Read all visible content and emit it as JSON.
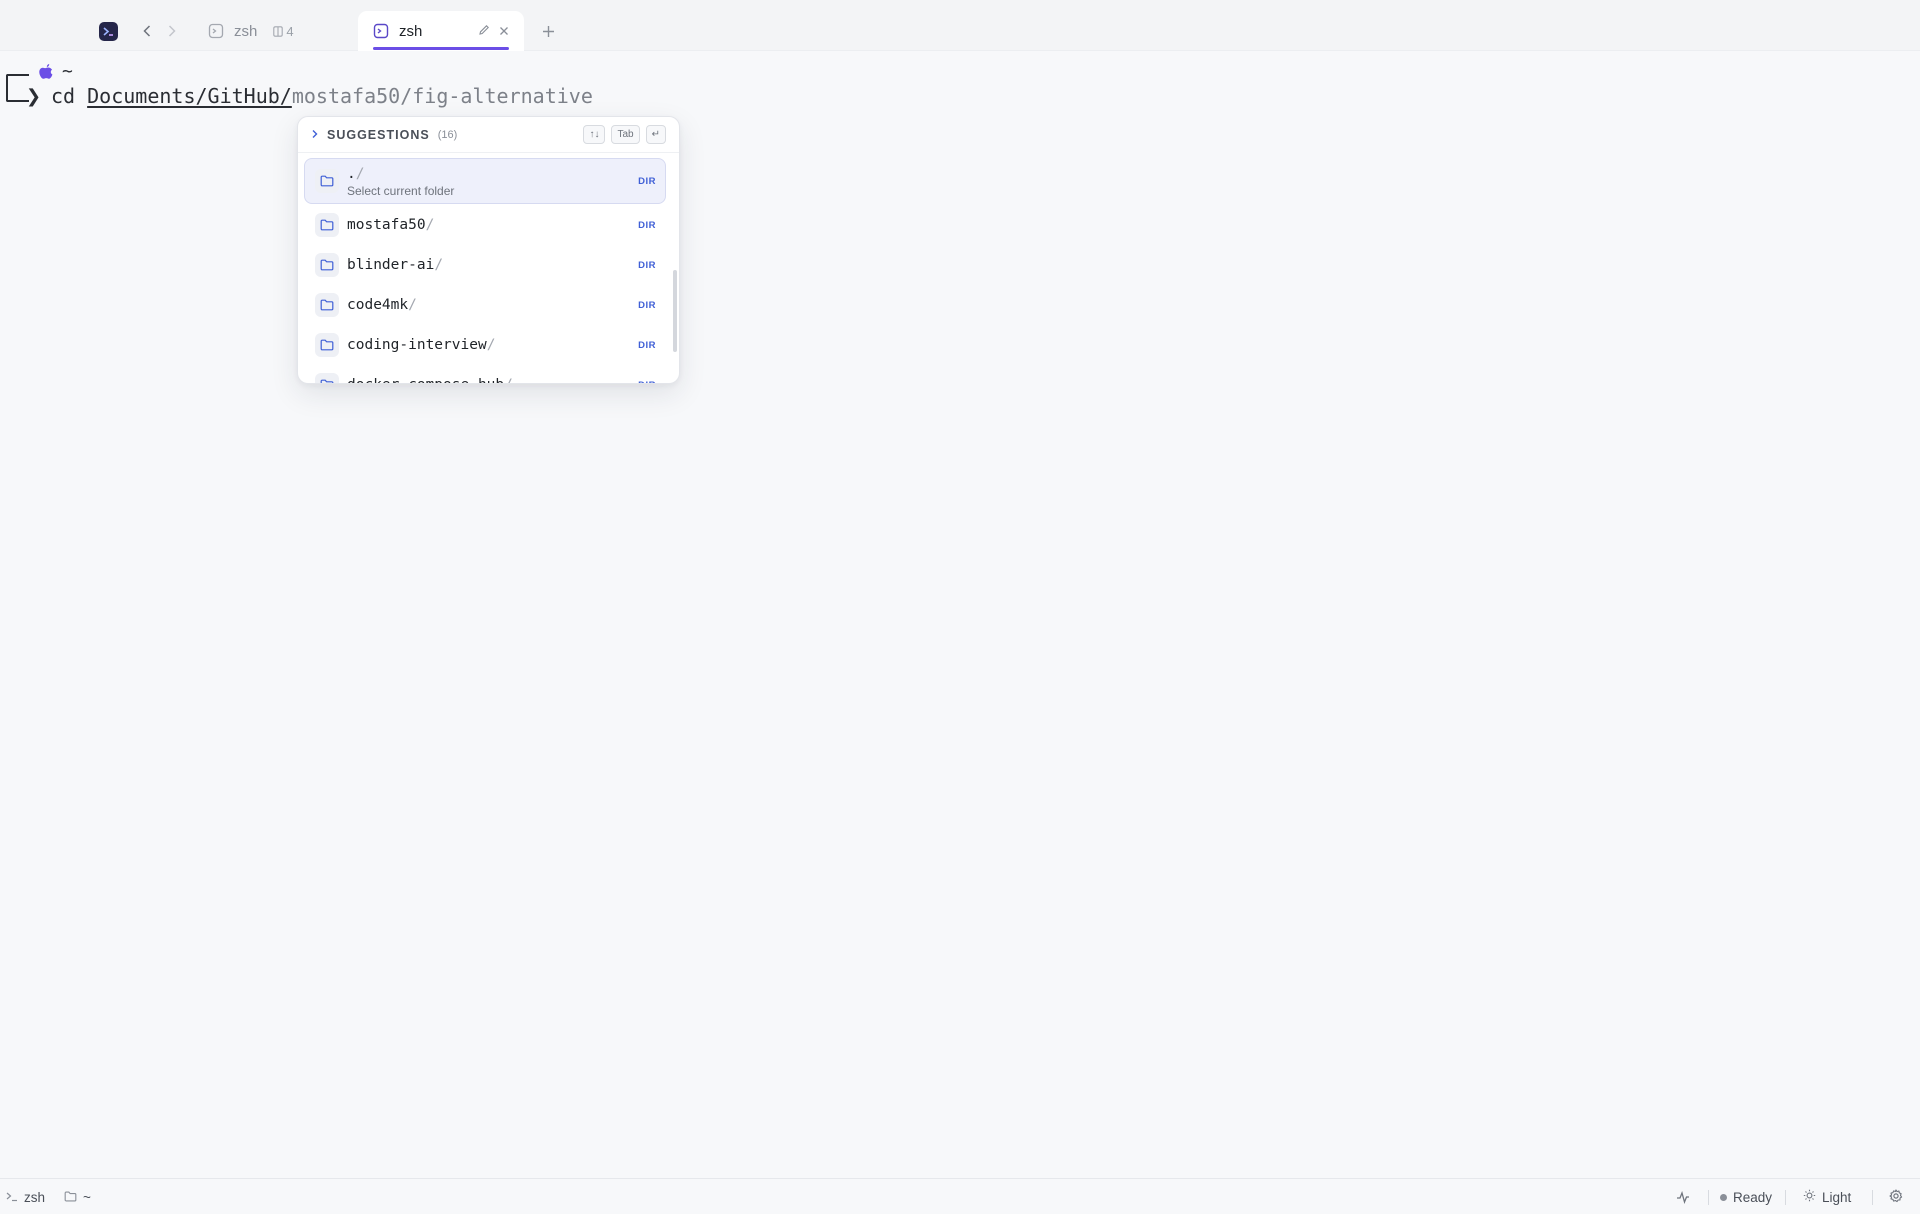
{
  "tabs": {
    "inactive": {
      "label": "zsh",
      "count": "4"
    },
    "active": {
      "label": "zsh"
    }
  },
  "terminal": {
    "cwd": "~",
    "command": "cd ",
    "typed_path": "Documents/GitHub/",
    "ghost_completion": "mostafa50/fig-alternative"
  },
  "suggestions": {
    "title": "SUGGESTIONS",
    "count": "(16)",
    "keys": {
      "navigate": "↑↓",
      "tab": "Tab",
      "enter": "↵"
    },
    "items": [
      {
        "name": ".",
        "slash": "/",
        "description": "Select current folder",
        "type": "DIR"
      },
      {
        "name": "mostafa50",
        "slash": "/",
        "type": "DIR"
      },
      {
        "name": "blinder-ai",
        "slash": "/",
        "type": "DIR"
      },
      {
        "name": "code4mk",
        "slash": "/",
        "type": "DIR"
      },
      {
        "name": "coding-interview",
        "slash": "/",
        "type": "DIR"
      },
      {
        "name": "docker-compose-hub",
        "slash": "/",
        "type": "DIR"
      }
    ]
  },
  "statusbar": {
    "shell": "zsh",
    "cwd": "~",
    "status": "Ready",
    "theme": "Light"
  },
  "colors": {
    "accent": "#6b4ee6",
    "dir_badge": "#3f5fd6",
    "background": "#f7f8fa"
  }
}
